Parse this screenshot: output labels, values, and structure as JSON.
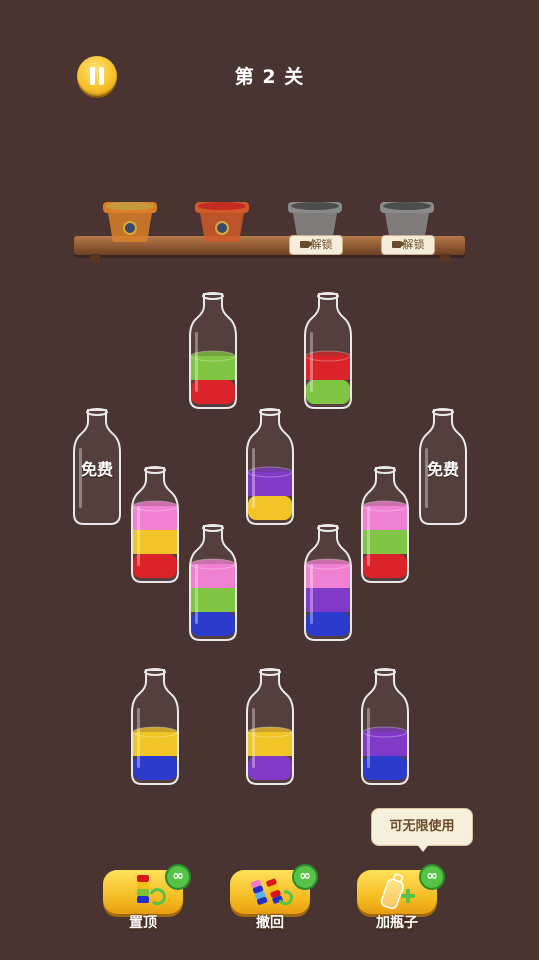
{
  "header": {
    "title": "第 2 关",
    "pause_icon": "pause-icon"
  },
  "shelf": {
    "pots": [
      {
        "state": "filled",
        "color": "#d97f2a",
        "soil": "#c79a3a",
        "icon": "flower-icon"
      },
      {
        "state": "filled",
        "color": "#d05a2a",
        "soil": "#c42b22",
        "icon": "flower-icon"
      },
      {
        "state": "locked",
        "color": "#8a8a8a",
        "unlock_label": "解锁",
        "icon": "video-icon"
      },
      {
        "state": "locked",
        "color": "#8a8a8a",
        "unlock_label": "解锁",
        "icon": "video-icon"
      }
    ]
  },
  "colors": {
    "green": "#7ac23a",
    "red": "#d8171c",
    "purple": "#7a2ec4",
    "yellow": "#f2c21a",
    "pink": "#f07ad0",
    "blue": "#1f2fc8"
  },
  "bottles": [
    {
      "id": "b1",
      "layers": [
        "red",
        "green"
      ],
      "free_label": ""
    },
    {
      "id": "b2",
      "layers": [
        "green",
        "red"
      ],
      "free_label": ""
    },
    {
      "id": "b3",
      "layers": [],
      "free_label": "免费"
    },
    {
      "id": "b4",
      "layers": [
        "yellow",
        "purple"
      ],
      "free_label": ""
    },
    {
      "id": "b5",
      "layers": [],
      "free_label": "免费"
    },
    {
      "id": "b6",
      "layers": [
        "red",
        "yellow",
        "pink"
      ],
      "free_label": ""
    },
    {
      "id": "b7",
      "layers": [
        "red",
        "green",
        "pink"
      ],
      "free_label": ""
    },
    {
      "id": "b8",
      "layers": [
        "blue",
        "green",
        "pink"
      ],
      "free_label": ""
    },
    {
      "id": "b9",
      "layers": [
        "blue",
        "purple",
        "pink"
      ],
      "free_label": ""
    },
    {
      "id": "b10",
      "layers": [
        "blue",
        "yellow"
      ],
      "free_label": ""
    },
    {
      "id": "b11",
      "layers": [
        "purple",
        "yellow"
      ],
      "free_label": ""
    },
    {
      "id": "b12",
      "layers": [
        "blue",
        "purple"
      ],
      "free_label": ""
    }
  ],
  "toolbar": {
    "top_label": "置顶",
    "undo_label": "撤回",
    "add_bottle_label": "加瓶子",
    "badge": "∞",
    "tooltip": "可无限使用"
  }
}
